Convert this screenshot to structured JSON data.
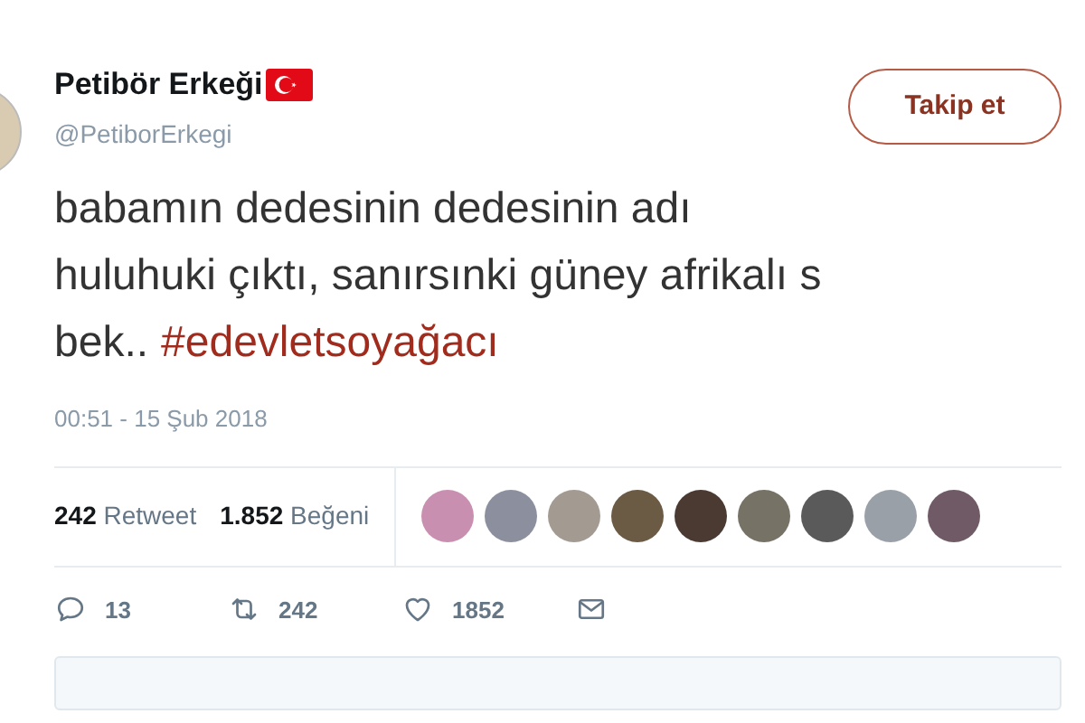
{
  "author": {
    "name": "Petibör Erkeği",
    "handle": "@PetiborErkegi"
  },
  "follow_button": {
    "label": "Takip et"
  },
  "tweet": {
    "lines": [
      "babamın dedesinin dedesinin adı",
      "huluhuki çıktı, sanırsınki güney afrikalı s",
      "bek.."
    ],
    "hashtag": "#edevletsoyağacı"
  },
  "timestamp": "00:51 - 15 Şub 2018",
  "stats": [
    {
      "count": "242",
      "label": "Retweet"
    },
    {
      "count": "1.852",
      "label": "Beğeni"
    }
  ],
  "actions": [
    {
      "kind": "reply",
      "count": "13"
    },
    {
      "kind": "retweet",
      "count": "242"
    },
    {
      "kind": "like",
      "count": "1852"
    },
    {
      "kind": "message"
    }
  ]
}
